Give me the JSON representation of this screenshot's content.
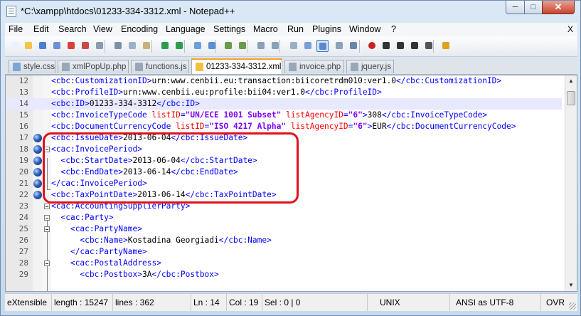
{
  "window": {
    "title": "*C:\\xampp\\htdocs\\01233-334-3312.xml - Notepad++"
  },
  "menubar": {
    "items": [
      "File",
      "Edit",
      "Search",
      "View",
      "Encoding",
      "Language",
      "Settings",
      "Macro",
      "Run",
      "Plugins",
      "Window",
      "?"
    ],
    "close_glyph": "X"
  },
  "toolbar": {
    "icons": [
      "new-file-icon",
      "open-file-icon",
      "save-icon",
      "save-all-icon",
      "close-icon",
      "close-all-icon",
      "print-icon",
      "cut-icon",
      "copy-icon",
      "paste-icon",
      "undo-icon",
      "redo-icon",
      "find-icon",
      "replace-icon",
      "zoom-in-icon",
      "zoom-out-icon",
      "sync-vertical-icon",
      "sync-horizontal-icon",
      "word-wrap-icon",
      "show-all-chars-icon",
      "indent-guide-icon",
      "user-lang-icon",
      "doc-map-icon",
      "record-macro-icon",
      "stop-record-icon",
      "play-macro-icon",
      "play-multiple-icon",
      "save-macro-icon",
      "spellcheck-icon"
    ]
  },
  "tabs": [
    {
      "label": "style.css",
      "color": "#7aa7d8"
    },
    {
      "label": "xmlPopUp.php",
      "color": "#9aa7b8"
    },
    {
      "label": "functions.js",
      "color": "#9aa7b8"
    },
    {
      "label": "01233-334-3312.xml",
      "color": "#f0c040",
      "active": true
    },
    {
      "label": "invoice.php",
      "color": "#9aa7b8"
    },
    {
      "label": "jquery.js",
      "color": "#9aa7b8"
    }
  ],
  "editor": {
    "lines": [
      {
        "n": "12",
        "html": "<span class=\"t\">&lt;cbc:CustomizationID&gt;</span>urn:www.cenbii.eu:transaction:biicoretrdm010:ver1.0<span class=\"t\">&lt;/cbc:CustomizationID&gt;</span>"
      },
      {
        "n": "13",
        "html": "<span class=\"t\">&lt;cbc:ProfileID&gt;</span>urn:www.cenbii.eu:profile:bii04:ver1.0<span class=\"t\">&lt;/cbc:ProfileID&gt;</span>"
      },
      {
        "n": "14",
        "html": "<span class=\"t\">&lt;cbc:ID&gt;</span>01233-334-3312<span class=\"t\">&lt;/cbc:ID&gt;</span>",
        "current": true
      },
      {
        "n": "15",
        "html": "<span class=\"t\">&lt;cbc:InvoiceTypeCode </span><span class=\"a\">listID</span><span class=\"t\">=</span><span class=\"v\">\"UN/ECE 1001 Subset\"</span><span class=\"t\"> </span><span class=\"a\">listAgencyID</span><span class=\"t\">=</span><span class=\"v\">\"6\"</span><span class=\"t\">&gt;</span>308<span class=\"t\">&lt;/cbc:InvoiceTypeCode&gt;</span>"
      },
      {
        "n": "16",
        "html": "<span class=\"t\">&lt;cbc:DocumentCurrencyCode </span><span class=\"a\">listID</span><span class=\"t\">=</span><span class=\"v\">\"ISO 4217 Alpha\"</span><span class=\"t\"> </span><span class=\"a\">listAgencyID</span><span class=\"t\">=</span><span class=\"v\">\"6\"</span><span class=\"t\">&gt;</span>EUR<span class=\"t\">&lt;/cbc:DocumentCurrencyCode&gt;</span>"
      },
      {
        "n": "17",
        "html": "<span class=\"t\">&lt;cbc:IssueDate&gt;</span>2013-06-04<span class=\"t\">&lt;/cbc:IssueDate&gt;</span>",
        "bookmark": true
      },
      {
        "n": "18",
        "html": "<span class=\"t\">&lt;cac:InvoicePeriod&gt;</span>",
        "bookmark": true,
        "fold": true
      },
      {
        "n": "19",
        "html": "  <span class=\"t\">&lt;cbc:StartDate&gt;</span>2013-06-04<span class=\"t\">&lt;/cbc:StartDate&gt;</span>",
        "bookmark": true
      },
      {
        "n": "20",
        "html": "  <span class=\"t\">&lt;cbc:EndDate&gt;</span>2013-06-14<span class=\"t\">&lt;/cbc:EndDate&gt;</span>",
        "bookmark": true
      },
      {
        "n": "21",
        "html": "<span class=\"t\">&lt;/cac:InvoicePeriod&gt;</span>",
        "bookmark": true
      },
      {
        "n": "22",
        "html": "<span class=\"t\">&lt;cbc:TaxPointDate&gt;</span>2013-06-14<span class=\"t\">&lt;/cbc:TaxPointDate&gt;</span>",
        "bookmark": true
      },
      {
        "n": "23",
        "html": "<span class=\"t\">&lt;cac:AccountingSupplierParty&gt;</span>",
        "fold": true
      },
      {
        "n": "24",
        "html": "  <span class=\"t\">&lt;cac:Party&gt;</span>",
        "fold": true
      },
      {
        "n": "25",
        "html": "    <span class=\"t\">&lt;cac:PartyName&gt;</span>",
        "fold": true
      },
      {
        "n": "26",
        "html": "      <span class=\"t\">&lt;cbc:Name&gt;</span>Kostadina Georgiadi<span class=\"t\">&lt;/cbc:Name&gt;</span>"
      },
      {
        "n": "27",
        "html": "    <span class=\"t\">&lt;/cac:PartyName&gt;</span>"
      },
      {
        "n": "28",
        "html": "    <span class=\"t\">&lt;cac:PostalAddress&gt;</span>",
        "fold": true
      },
      {
        "n": "29",
        "html": "      <span class=\"t\">&lt;cbc:Postbox&gt;</span>3A<span class=\"t\">&lt;/cbc:Postbox&gt;</span>"
      }
    ]
  },
  "statusbar": {
    "lang": "eXtensible",
    "length": "length : 15247",
    "lines": "lines : 362",
    "ln": "Ln : 14",
    "col": "Col : 19",
    "sel": "Sel : 0 | 0",
    "eol": "UNIX",
    "encoding": "ANSI as UTF-8",
    "mode": "OVR"
  }
}
